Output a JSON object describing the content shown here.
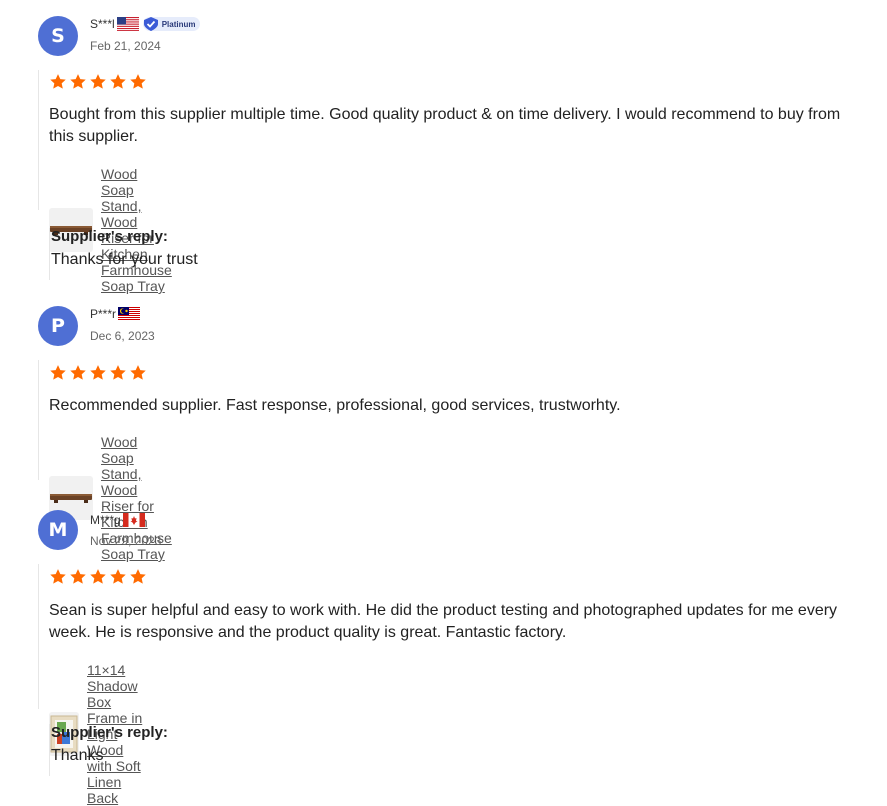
{
  "colors": {
    "avatar": "#4f6fd4",
    "star": "#ff6a00",
    "link": "#555555",
    "badge_bg": "#e6ecfb"
  },
  "reviews": [
    {
      "initial": "S",
      "name": "S***l",
      "flag": "us-flag",
      "badge": "Platinum",
      "date": "Feb 21, 2024",
      "rating": 5,
      "text": "Bought from this supplier multiple time. Good quality product & on time delivery. I would recommend to buy from this supplier.",
      "product": "Wood Soap Stand, Wood Riser for Kitchen Farmhouse Soap Tray",
      "reply_title": "Supplier's reply:",
      "reply": "Thanks for your trust"
    },
    {
      "initial": "P",
      "name": "P***r",
      "flag": "malaysia-flag",
      "date": "Dec 6, 2023",
      "rating": 5,
      "text": "Recommended supplier. Fast response, professional, good services, trustworhty.",
      "product": "Wood Soap Stand, Wood Riser for Kitchen Farmhouse Soap Tray"
    },
    {
      "initial": "M",
      "name": "M***g",
      "flag": "canada-flag",
      "date": "Nov 29, 2023",
      "rating": 5,
      "text": "Sean is super helpful and easy to work with. He did the product testing and photographed updates for me every week. He is responsive and the product quality is great. Fantastic factory.",
      "product": "11×14 Shadow Box Frame in Light Wood with Soft Linen Back",
      "reply_title": "Supplier's reply:",
      "reply": "Thanks"
    }
  ]
}
